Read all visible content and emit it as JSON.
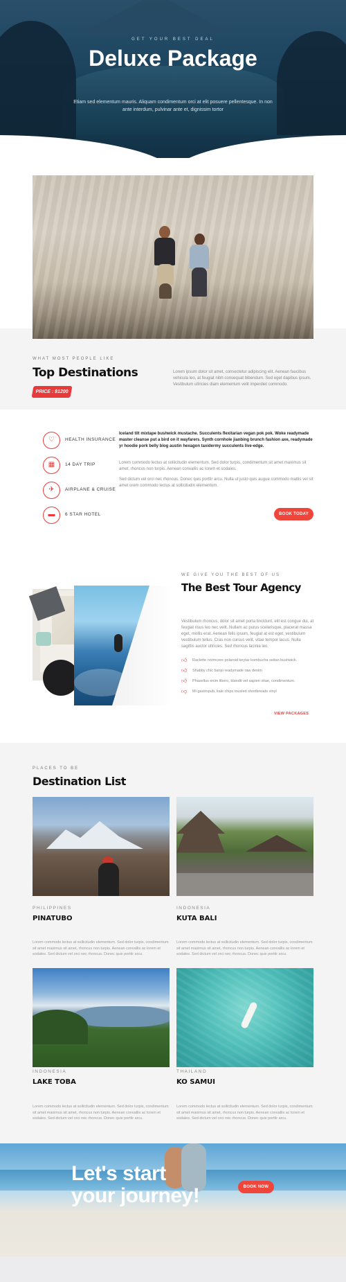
{
  "hero": {
    "eyebrow": "GET YOUR BEST DEAL",
    "title": "Deluxe Package",
    "text": "Etiam sed elementum mauris. Aliquam condimentum orci at elit posuere pellentesque. In non ante interdum, pulvinar ante et, dignissim tortor"
  },
  "top": {
    "eyebrow": "WHAT MOST PEOPLE LIKE",
    "title": "Top Destinations",
    "price": "PRICE : $1200",
    "text": "Lorem ipsum dolor sit amet, consectetur adipiscing elit. Aenean faucibus vehicula leo, at feugiat nibh consequat bibendum. Sed eget dapibus ipsum. Vestibulum ultricies diam elementum velit imperdiet commodo."
  },
  "features": {
    "items": [
      {
        "label": "HEALTH INSURANCE",
        "icon": "heart-icon"
      },
      {
        "label": "14 DAY TRIP",
        "icon": "calendar-icon"
      },
      {
        "label": "AIRPLANE & CRUISE",
        "icon": "airplane-icon"
      },
      {
        "label": "6 STAR HOTEL",
        "icon": "bed-icon"
      }
    ],
    "strong_text": "Iceland tilt mixtape bushwick mustache. Succulents flexitarian vegan pok pok. Woke readymade master cleanse put a bird on it wayfarers. Synth cornhole jianbing brunch fashion axe, readymade yr hoodie pork belly blog austin hexagon taxidermy succulents live-edge.",
    "text1": "Lorem commodo lectus at sollicitudin elementum. Sed dolor turpis, condimentum sit amet maximus sit amet, rhoncus non turpis. Aenean convallis ac lorem et sodales.",
    "text2": "Sed dictum vel orci nec rhoncus. Donec quis porttir arcu. Nulla ut justo quis augue commodo mattis vel sit amet orem commodo lectus at sollicitudin elementum.",
    "button": "BOOK TODAY"
  },
  "agency": {
    "eyebrow": "WE GIVE YOU THE BEST OF US",
    "title": "The Best Tour Agency",
    "text": "Vestibulum rhoncus, dolor sit amet porta tincidunt, elit est congue dui, at feugiat risus leo nec velit. Nullam ac purus scelerisque, placerat massa eget, mollis erat. Aenean felis ipsum, feugiat at est eget, vestibulum vestibulum tellus. Cras non cursus velit, vitae tempor lacus. Nulla sagittis auctor ultricies. Sed rhoncus lacinia leo.",
    "checks": [
      "Raclette normcore polaroid keytar kombucha seitan bushwick.",
      "Shabby chic banjo readymade raw denim",
      "Phasellus enim libero, blandit vel sapien vitae, condimentum.",
      "Mi gastropub, kale chips tousled shortbreads vinyl"
    ],
    "link": "VIEW PACKAGES"
  },
  "destinations": {
    "eyebrow": "PLACES TO BE",
    "title": "Destination List",
    "items": [
      {
        "country": "PHILIPPINES",
        "name": "PINATUBO",
        "desc": "Lorem commodo lectus at sollicitudin elementum. Sed dolor turpis, condimentum sit amet maximus sit amet, rhoncus non turpis. Aenean convallis ac lorem et sodales. Sed dictum vel orci nec rhoncus. Donec quis porttir arcu."
      },
      {
        "country": "INDONESIA",
        "name": "KUTA BALI",
        "desc": "Lorem commodo lectus at sollicitudin elementum. Sed dolor turpis, condimentum sit amet maximus sit amet, rhoncus non turpis. Aenean convallis ac lorem et sodales. Sed dictum vel orci nec rhoncus. Donec quis porttir arcu."
      },
      {
        "country": "INDONESIA",
        "name": "LAKE TOBA",
        "desc": "Lorem commodo lectus at sollicitudin elementum. Sed dolor turpis, condimentum sit amet maximus sit amet, rhoncus non turpis. Aenean convallis ac lorem et sodales. Sed dictum vel orci nec rhoncus. Donec quis porttir arcu."
      },
      {
        "country": "THAILAND",
        "name": "KO SAMUI",
        "desc": "Lorem commodo lectus at sollicitudin elementum. Sed dolor turpis, condimentum sit amet maximus sit amet, rhoncus non turpis. Aenean convallis ac lorem et sodales. Sed dictum vel orci nec rhoncus. Donec quis porttir arcu."
      }
    ]
  },
  "cta": {
    "title_line1": "Let's start",
    "title_line2": "your journey!",
    "button": "BOOK NOW"
  },
  "colors": {
    "accent": "#e83a3a",
    "hero": "#1e4660"
  }
}
